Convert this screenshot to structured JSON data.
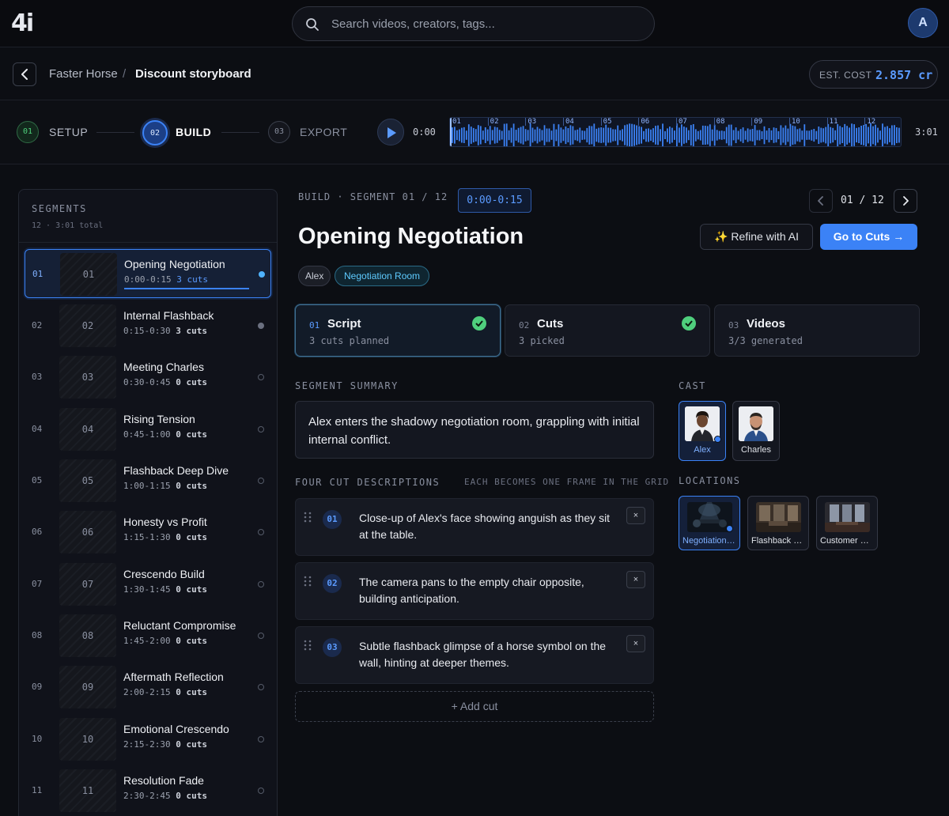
{
  "app": {
    "logo": "4i"
  },
  "search": {
    "placeholder": "Search videos, creators, tags..."
  },
  "user": {
    "avatar_initial": "A"
  },
  "breadcrumb": {
    "parent": "Faster Horse",
    "separator": "/",
    "current": "Discount storyboard"
  },
  "cost": {
    "label": "EST. COST",
    "value": "2.857 cr"
  },
  "steps": [
    {
      "num": "01",
      "label": "SETUP",
      "state": "done"
    },
    {
      "num": "02",
      "label": "BUILD",
      "state": "active"
    },
    {
      "num": "03",
      "label": "EXPORT",
      "state": "pending"
    }
  ],
  "player": {
    "current_time": "0:00",
    "total_time": "3:01",
    "ticks": [
      "01",
      "02",
      "03",
      "04",
      "05",
      "06",
      "07",
      "08",
      "09",
      "10",
      "11",
      "12"
    ]
  },
  "sidebar": {
    "title": "SEGMENTS",
    "subtitle": "12 · 3:01 total",
    "segments": [
      {
        "num": "01",
        "name": "Opening Negotiation",
        "range": "0:00-0:15",
        "cuts": "3 cuts",
        "status": "active"
      },
      {
        "num": "02",
        "name": "Internal Flashback",
        "range": "0:15-0:30",
        "cuts": "3 cuts",
        "status": "partial"
      },
      {
        "num": "03",
        "name": "Meeting Charles",
        "range": "0:30-0:45",
        "cuts": "0 cuts",
        "status": "empty"
      },
      {
        "num": "04",
        "name": "Rising Tension",
        "range": "0:45-1:00",
        "cuts": "0 cuts",
        "status": "empty"
      },
      {
        "num": "05",
        "name": "Flashback Deep Dive",
        "range": "1:00-1:15",
        "cuts": "0 cuts",
        "status": "empty"
      },
      {
        "num": "06",
        "name": "Honesty vs Profit",
        "range": "1:15-1:30",
        "cuts": "0 cuts",
        "status": "empty"
      },
      {
        "num": "07",
        "name": "Crescendo Build",
        "range": "1:30-1:45",
        "cuts": "0 cuts",
        "status": "empty"
      },
      {
        "num": "08",
        "name": "Reluctant Compromise",
        "range": "1:45-2:00",
        "cuts": "0 cuts",
        "status": "empty"
      },
      {
        "num": "09",
        "name": "Aftermath Reflection",
        "range": "2:00-2:15",
        "cuts": "0 cuts",
        "status": "empty"
      },
      {
        "num": "10",
        "name": "Emotional Crescendo",
        "range": "2:15-2:30",
        "cuts": "0 cuts",
        "status": "empty"
      },
      {
        "num": "11",
        "name": "Resolution Fade",
        "range": "2:30-2:45",
        "cuts": "0 cuts",
        "status": "empty"
      }
    ]
  },
  "main": {
    "breadcrumb": "BUILD · SEGMENT 01 / 12",
    "time_chip": "0:00-0:15",
    "pager": "01 / 12",
    "title": "Opening Negotiation",
    "refine_label": "✨ Refine with AI",
    "go_cuts_label": "Go to Cuts →",
    "tags": [
      "Alex",
      "Negotiation Room"
    ],
    "cards": [
      {
        "num": "01",
        "title": "Script",
        "sub": "3 cuts planned",
        "done": true
      },
      {
        "num": "02",
        "title": "Cuts",
        "sub": "3 picked",
        "done": true
      },
      {
        "num": "03",
        "title": "Videos",
        "sub": "3/3 generated",
        "done": false
      }
    ],
    "summary_label": "SEGMENT SUMMARY",
    "summary": "Alex enters the shadowy negotiation room, grappling with initial internal conflict.",
    "cuts_label": "FOUR CUT DESCRIPTIONS",
    "cuts_hint": "EACH BECOMES ONE FRAME IN THE GRID",
    "cuts": [
      {
        "num": "01",
        "text": "Close-up of Alex's face showing anguish as they sit at the table."
      },
      {
        "num": "02",
        "text": "The camera pans to the empty chair opposite, building anticipation."
      },
      {
        "num": "03",
        "text": "Subtle flashback glimpse of a horse symbol on the wall, hinting at deeper themes."
      }
    ],
    "remove_label": "×",
    "add_cut_label": "+ Add cut",
    "cast_label": "CAST",
    "cast": [
      {
        "name": "Alex",
        "selected": true
      },
      {
        "name": "Charles",
        "selected": false
      }
    ],
    "locations_label": "LOCATIONS",
    "locations": [
      {
        "name": "Negotiation Room",
        "selected": true
      },
      {
        "name": "Flashback Space",
        "selected": false
      },
      {
        "name": "Customer Office",
        "selected": false
      }
    ]
  },
  "colors": {
    "accent": "#3b82f6",
    "success": "#4fcf7d",
    "background": "#0c0e13"
  }
}
